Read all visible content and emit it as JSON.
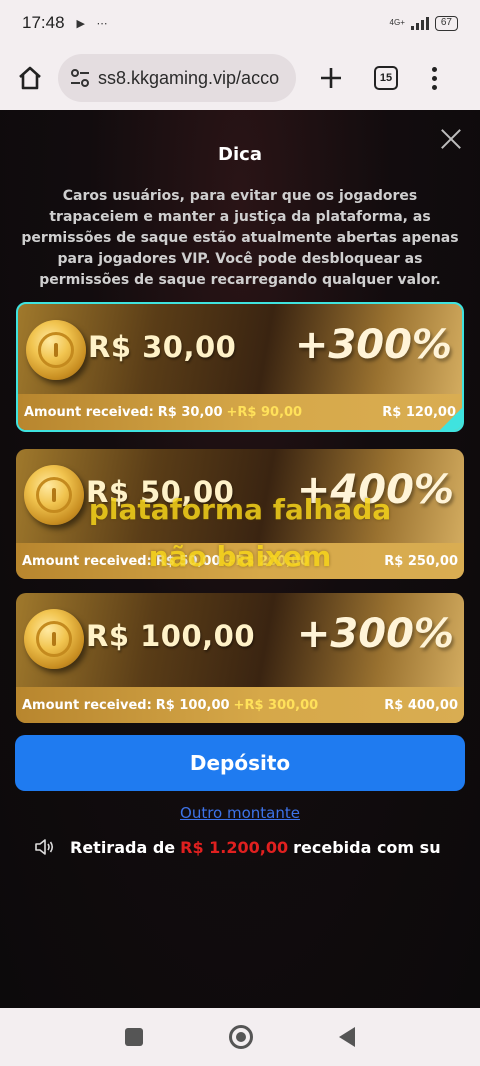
{
  "status_bar": {
    "time": "17:48",
    "notification_icons": "▶ ⋯",
    "network": "4G+",
    "battery": "67"
  },
  "browser": {
    "url": "ss8.kkgaming.vip/acco",
    "tab_count": "15"
  },
  "dialog": {
    "title": "Dica",
    "message": "Caros usuários, para evitar que os jogadores trapaceiem e manter a justiça da plataforma, as permissões de saque estão atualmente abertas apenas para jogadores VIP. Você pode desbloquear as permissões de saque recarregando qualquer valor."
  },
  "offers": [
    {
      "amount": "R$ 30,00",
      "bonus": "+300%",
      "received_label": "Amount received:",
      "received_base": "R$ 30,00",
      "received_extra": "+R$ 90,00",
      "total": "R$ 120,00",
      "selected": true
    },
    {
      "amount": "R$ 50,00",
      "bonus": "+400%",
      "received_label": "Amount received:",
      "received_base": "R$ 50,00",
      "received_extra": "+R$ 200,00",
      "total": "R$ 250,00",
      "selected": false
    },
    {
      "amount": "R$ 100,00",
      "bonus": "+300%",
      "received_label": "Amount received:",
      "received_base": "R$ 100,00",
      "received_extra": "+R$ 300,00",
      "total": "R$ 400,00",
      "selected": false
    }
  ],
  "watermark": {
    "line1": "plataforma falhada",
    "line2": "não baixem"
  },
  "deposit_button": "Depósito",
  "other_amount_link": "Outro montante",
  "ticker": {
    "prefix": "Retirada de",
    "amount": "R$ 1.200,00",
    "suffix": "recebida com su"
  },
  "colors": {
    "accent_blue": "#1f7bf0",
    "selected_border": "#3fe3df",
    "ticker_amount": "#e0201f",
    "bonus_highlight": "#ffe15a"
  }
}
